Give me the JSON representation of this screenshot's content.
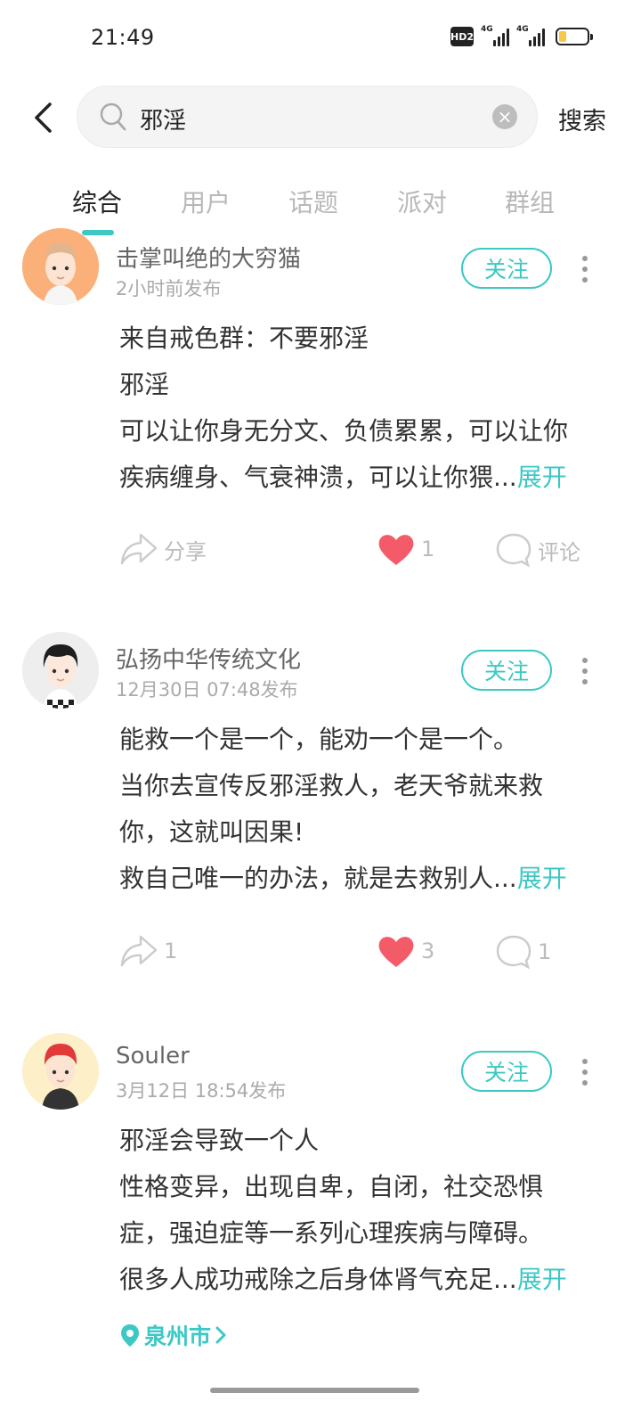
{
  "status_bar": {
    "time": "21:49",
    "hd_badge": "HD2",
    "signal1_tag": "4G",
    "signal2_tag": "4G",
    "battery_level": 0.25,
    "battery_color": "#f5c84a"
  },
  "search": {
    "query": "邪淫",
    "search_button": "搜索",
    "icons": [
      "back-icon",
      "search-icon",
      "clear-icon"
    ]
  },
  "tabs": [
    "综合",
    "用户",
    "话题",
    "派对",
    "群组"
  ],
  "active_tab": 0,
  "accent_color": "#3cc8c4",
  "like_color": "#f45b69",
  "posts": [
    {
      "username": "击掌叫绝的大穷猫",
      "time": "2小时前发布",
      "follow": "关注",
      "lines": [
        "来自戒色群：不要邪淫",
        "邪淫",
        "可以让你身无分文、负债累累，可以让你",
        "疾病缠身、气衰神溃，可以让你猥..."
      ],
      "expand": "展开",
      "share": "分享",
      "likes": "1",
      "comment": "评论",
      "avatar_color": "#fbb07a"
    },
    {
      "username": "弘扬中华传统文化",
      "time": "12月30日 07:48发布",
      "follow": "关注",
      "lines": [
        "能救一个是一个，能劝一个是一个。",
        "当你去宣传反邪淫救人，老天爷就来救",
        "你，这就叫因果!",
        "救自己唯一的办法，就是去救别人..."
      ],
      "expand": "展开",
      "share": "1",
      "likes": "3",
      "comment": "1",
      "avatar_color": "#eeeeee"
    },
    {
      "username": "Souler",
      "time": "3月12日 18:54发布",
      "follow": "关注",
      "lines": [
        "邪淫会导致一个人",
        "性格变异，出现自卑，自闭，社交恐惧",
        "症，强迫症等一系列心理疾病与障碍。",
        "很多人成功戒除之后身体肾气充足..."
      ],
      "expand": "展开",
      "location": "泉州市",
      "avatar_color": "#fdf0c8"
    }
  ]
}
